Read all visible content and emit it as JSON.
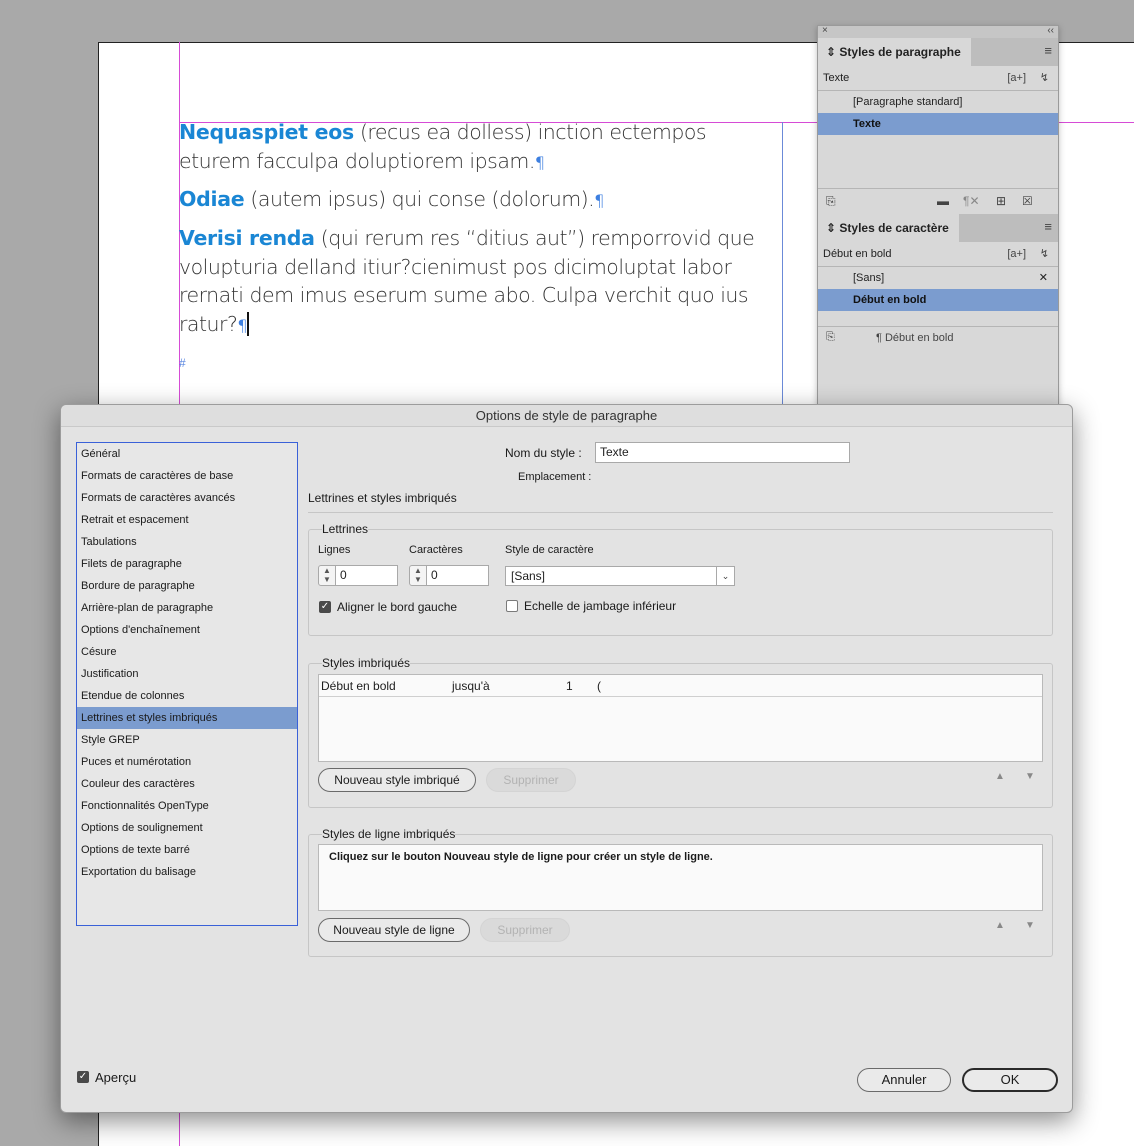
{
  "document": {
    "paragraphs": [
      {
        "lead": "Nequaspiet eos",
        "line1": "(recus ea dolless) inction ectempos",
        "line2": "eturem facculpa doluptiorem ipsam."
      },
      {
        "lead": "Odiae",
        "line1": "(autem ipsus) qui conse (dolorum)."
      },
      {
        "lead": "Verisi renda",
        "line1": "(qui rerum res “ditius aut”) remporrovid que",
        "line2": "volupturia delland itiur?cienimust pos dicimoluptat labor",
        "line3": "rernati dem imus eserum sume abo. Culpa verchit quo ius",
        "line4": "ratur?"
      }
    ],
    "pilcrow": "¶",
    "end_marker": "#"
  },
  "para_styles_panel": {
    "close": "×",
    "collapse": "‹‹",
    "tab": "⇕ Styles de paragraphe",
    "current": "Texte",
    "items": [
      "[Paragraphe standard]",
      "Texte"
    ],
    "selected_index": 1
  },
  "char_styles_panel": {
    "tab": "⇕ Styles de caractère",
    "current": "Début en bold",
    "items": [
      "[Sans]",
      "Début en bold"
    ],
    "footer_label": "¶ Début en bold"
  },
  "dialog": {
    "title": "Options de style de paragraphe",
    "categories": [
      "Général",
      "Formats de caractères de base",
      "Formats de caractères avancés",
      "Retrait et espacement",
      "Tabulations",
      "Filets de paragraphe",
      "Bordure de paragraphe",
      "Arrière-plan de paragraphe",
      "Options d'enchaînement",
      "Césure",
      "Justification",
      "Etendue de colonnes",
      "Lettrines et styles imbriqués",
      "Style GREP",
      "Puces et numérotation",
      "Couleur des caractères",
      "Fonctionnalités OpenType",
      "Options de soulignement",
      "Options de texte barré",
      "Exportation du balisage"
    ],
    "selected_category": 12,
    "style_name_label": "Nom du style :",
    "style_name_value": "Texte",
    "location_label": "Emplacement :",
    "section_title": "Lettrines et styles imbriqués",
    "drop_caps": {
      "title": "Lettrines",
      "lines_label": "Lignes",
      "lines_value": "0",
      "chars_label": "Caractères",
      "chars_value": "0",
      "char_style_label": "Style de caractère",
      "char_style_value": "[Sans]",
      "align_left_label": "Aligner le bord gauche",
      "align_left_checked": true,
      "scale_descenders_label": "Echelle de jambage inférieur",
      "scale_descenders_checked": false
    },
    "nested_styles": {
      "title": "Styles imbriqués",
      "rows": [
        {
          "style": "Début en bold",
          "through": "jusqu'à",
          "count": "1",
          "char": "("
        }
      ],
      "new_button": "Nouveau style imbriqué",
      "delete_button": "Supprimer"
    },
    "nested_line_styles": {
      "title": "Styles de ligne imbriqués",
      "hint": "Cliquez sur le bouton Nouveau style de ligne pour créer un style de ligne.",
      "new_button": "Nouveau style de ligne",
      "delete_button": "Supprimer"
    },
    "preview_label": "Aperçu",
    "preview_checked": true,
    "cancel_button": "Annuler",
    "ok_button": "OK"
  }
}
